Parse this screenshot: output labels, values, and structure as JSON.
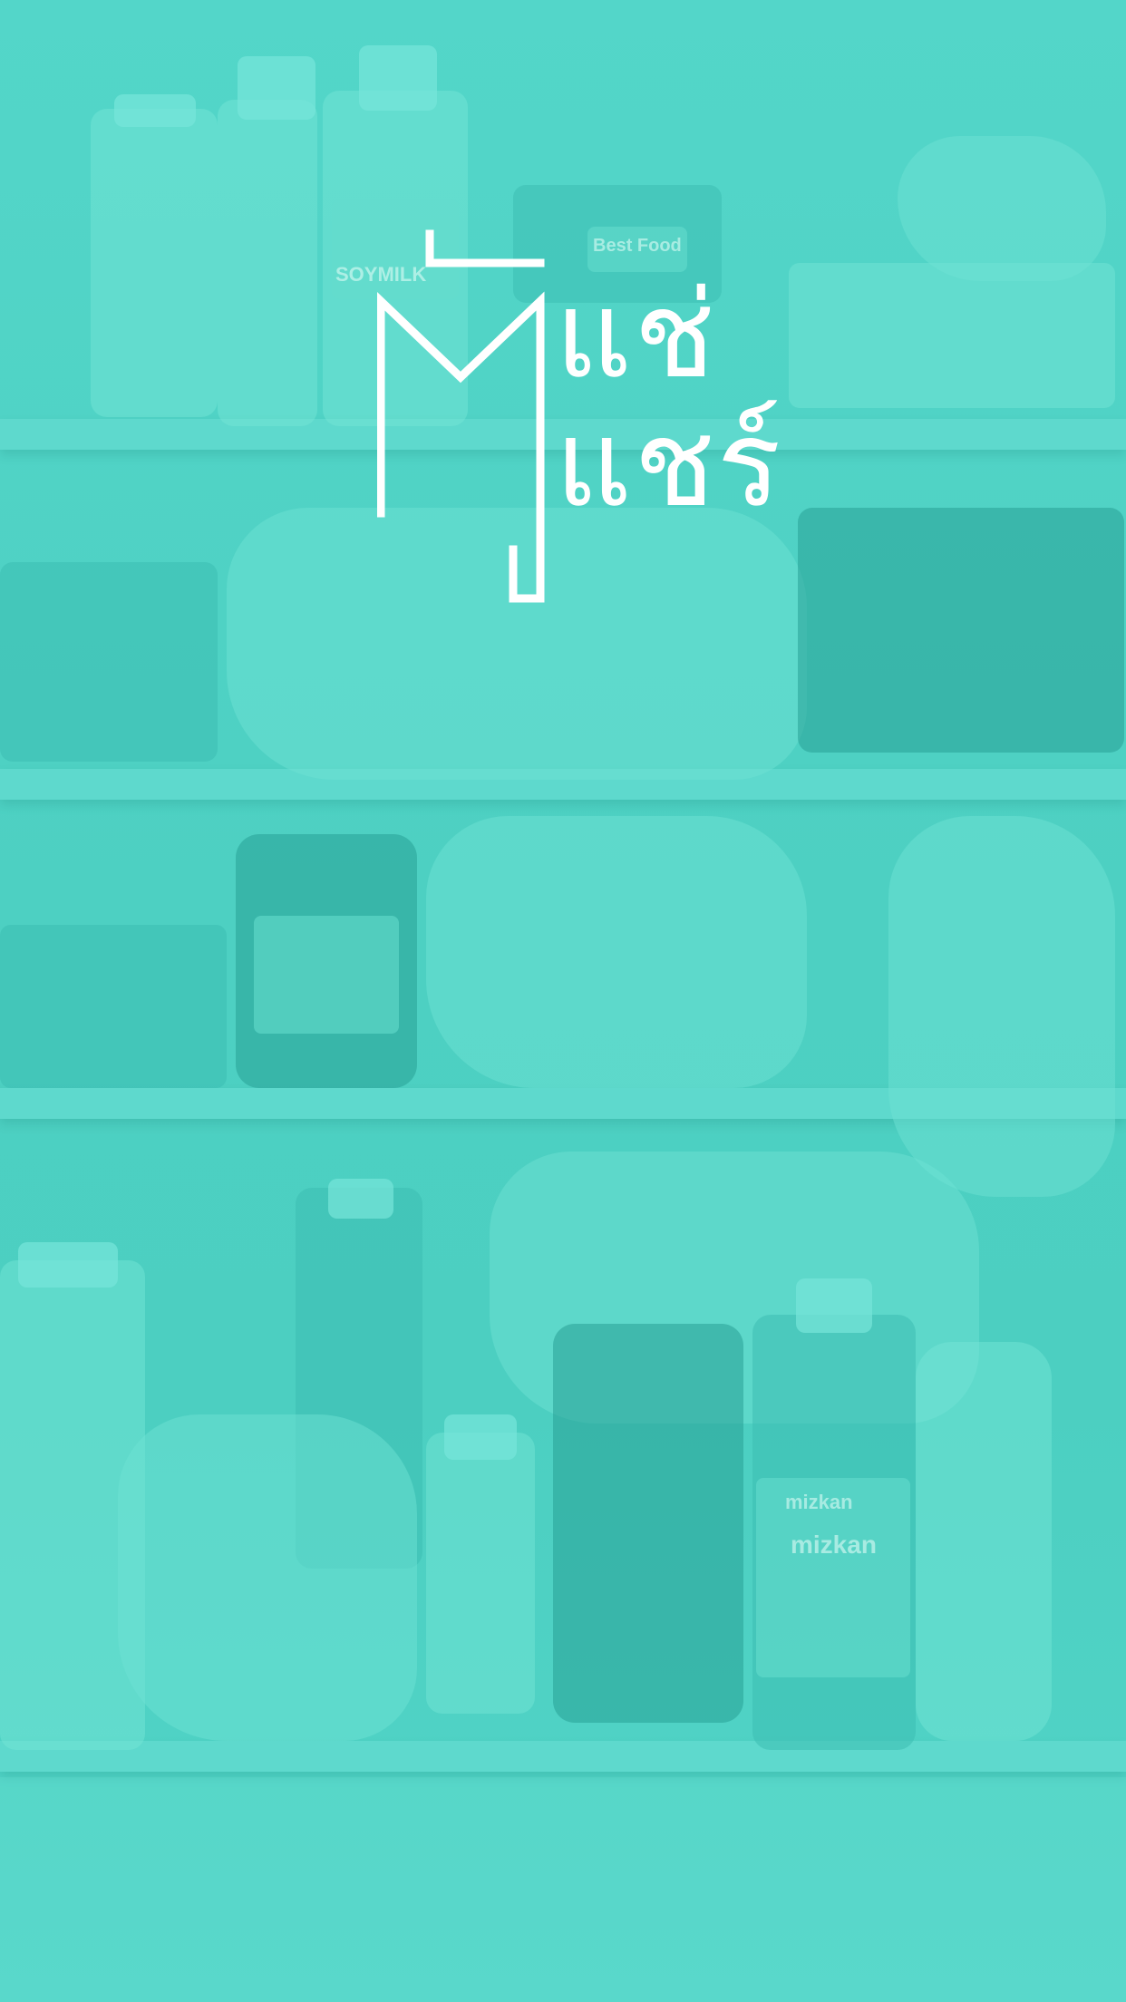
{
  "app": {
    "name_line1": "แช่",
    "name_line2": "แชร์",
    "logo_mark": "ตู้"
  },
  "background": {
    "accent": "#4fd3c6",
    "photo_text": {
      "brand1": "Best Food",
      "brand2": "mizkan",
      "brand3": "mizkan",
      "drink": "SOYMILK"
    }
  }
}
